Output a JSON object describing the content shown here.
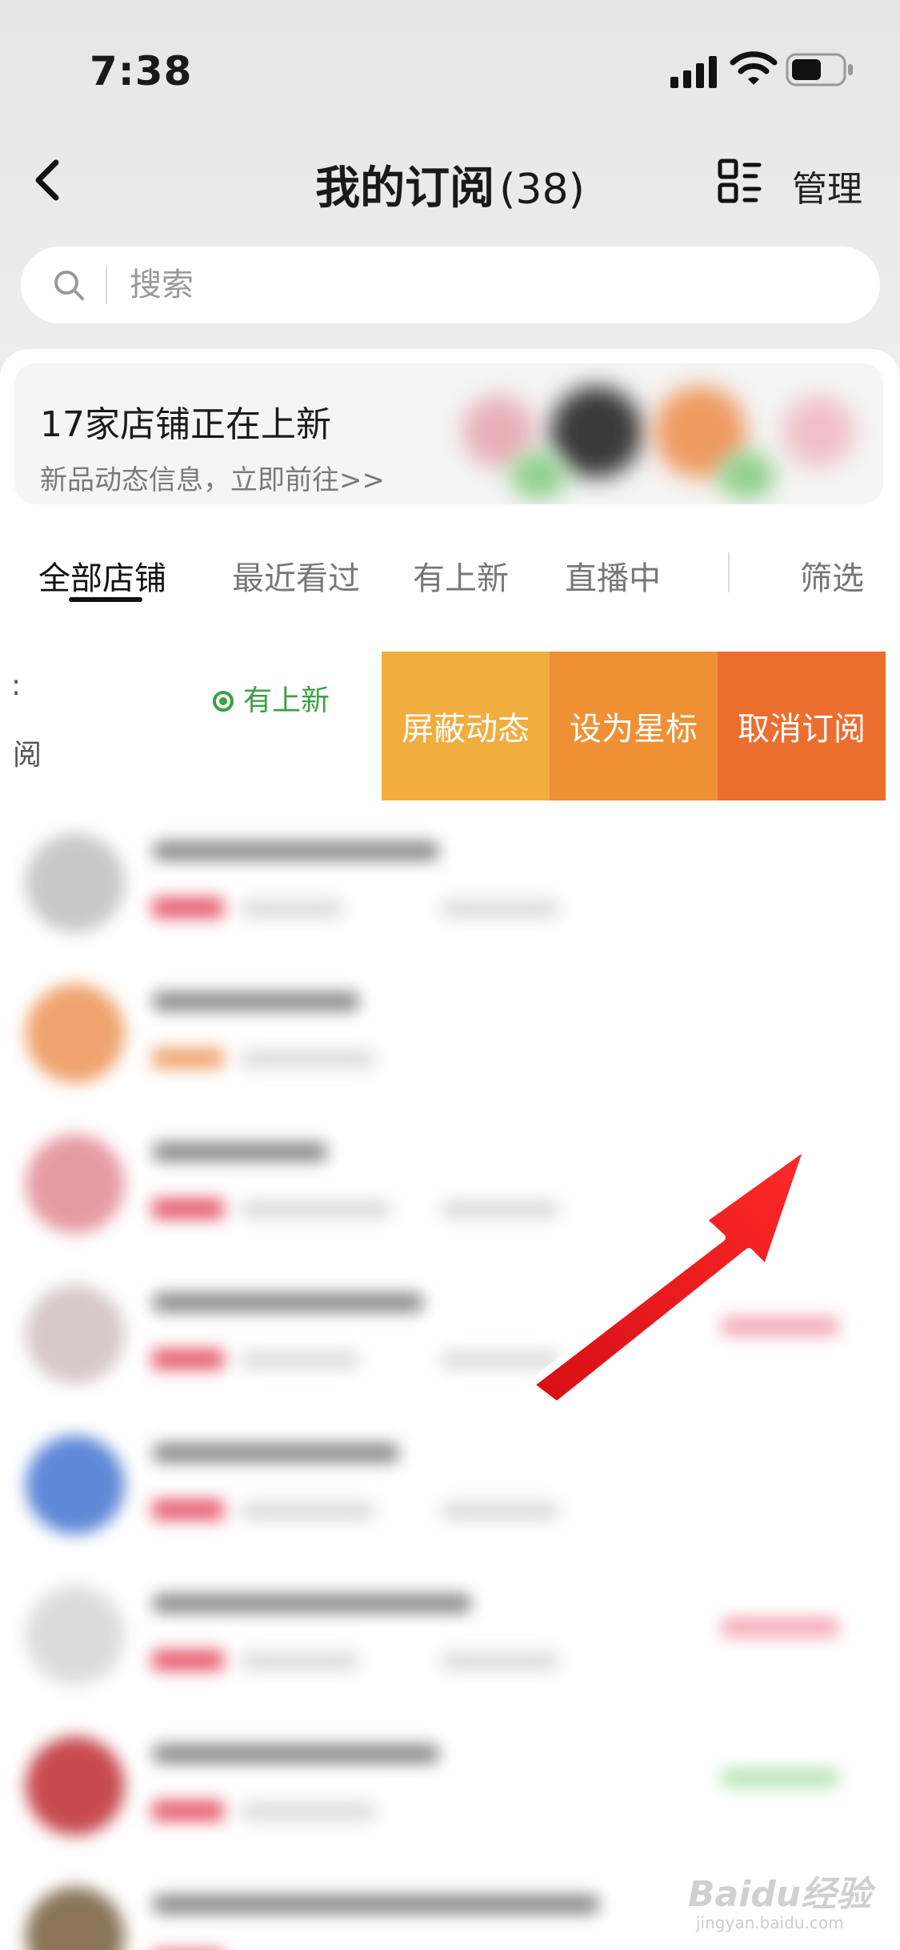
{
  "status_bar": {
    "time": "7:38"
  },
  "nav": {
    "title": "我的订阅",
    "count": "(38)",
    "manage_label": "管理"
  },
  "search": {
    "placeholder": "搜索"
  },
  "banner": {
    "title": "17家店铺正在上新",
    "subtitle": "新品动态信息，立即前往>>"
  },
  "tabs": [
    {
      "label": "全部店铺",
      "active": true
    },
    {
      "label": "最近看过",
      "active": false
    },
    {
      "label": "有上新",
      "active": false
    },
    {
      "label": "直播中",
      "active": false
    },
    {
      "label": "筛选",
      "active": false
    }
  ],
  "swiped_row": {
    "fragment_top": ":",
    "fragment_bottom": "阅",
    "new_badge": "有上新",
    "actions": {
      "mute": "屏蔽动态",
      "star": "设为星标",
      "unsubscribe": "取消订阅"
    }
  },
  "colors": {
    "mute_button": "#f2ad3f",
    "star_button": "#ef9035",
    "unsubscribe_button": "#ec6e2f",
    "new_badge": "#3aa142",
    "annotation_arrow": "#e3161b"
  },
  "watermark": {
    "brand": "Baidu经验",
    "url": "jingyan.baidu.com"
  }
}
